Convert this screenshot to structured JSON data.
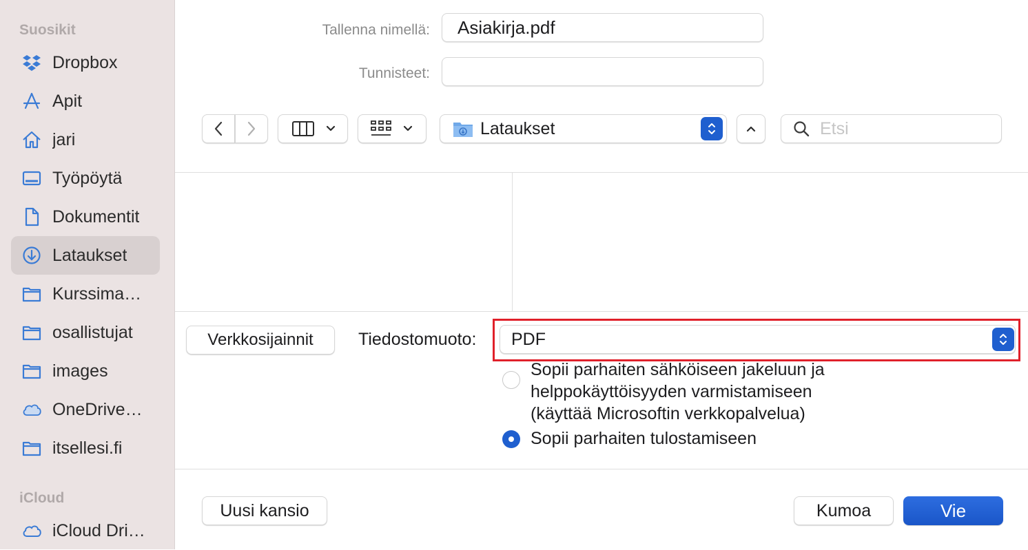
{
  "sidebar": {
    "favorites_header": "Suosikit",
    "icloud_header": "iCloud",
    "items": [
      {
        "label": "Dropbox",
        "icon": "dropbox-icon"
      },
      {
        "label": "Apit",
        "icon": "apps-icon"
      },
      {
        "label": "jari",
        "icon": "home-icon"
      },
      {
        "label": "Työpöytä",
        "icon": "desktop-icon"
      },
      {
        "label": "Dokumentit",
        "icon": "document-icon"
      },
      {
        "label": "Lataukset",
        "icon": "download-icon",
        "selected": true
      },
      {
        "label": "Kurssima…",
        "icon": "folder-icon"
      },
      {
        "label": "osallistujat",
        "icon": "folder-icon"
      },
      {
        "label": "images",
        "icon": "folder-icon"
      },
      {
        "label": "OneDrive…",
        "icon": "cloud-icon"
      },
      {
        "label": "itsellesi.fi",
        "icon": "folder-icon"
      }
    ],
    "icloud_items": [
      {
        "label": "iCloud Dri…",
        "icon": "cloud-icon"
      }
    ]
  },
  "save": {
    "name_label": "Tallenna nimellä:",
    "name_value": "Asiakirja.pdf",
    "tags_label": "Tunnisteet:",
    "tags_value": ""
  },
  "toolbar": {
    "location": "Lataukset",
    "search_placeholder": "Etsi"
  },
  "options": {
    "network_button": "Verkkosijainnit",
    "format_label": "Tiedostomuoto:",
    "format_value": "PDF",
    "radio1_lines": [
      "Sopii parhaiten sähköiseen jakeluun ja",
      "helppokäyttöisyyden varmistamiseen",
      "(käyttää Microsoftin verkkopalvelua)"
    ],
    "radio1_checked": false,
    "radio2": "Sopii parhaiten tulostamiseen",
    "radio2_checked": true
  },
  "footer": {
    "new_folder": "Uusi kansio",
    "cancel": "Kumoa",
    "export": "Vie"
  },
  "colors": {
    "accent": "#1f5fcf",
    "highlight": "#e0202a",
    "sidebar_icon": "#3a7bd5"
  }
}
